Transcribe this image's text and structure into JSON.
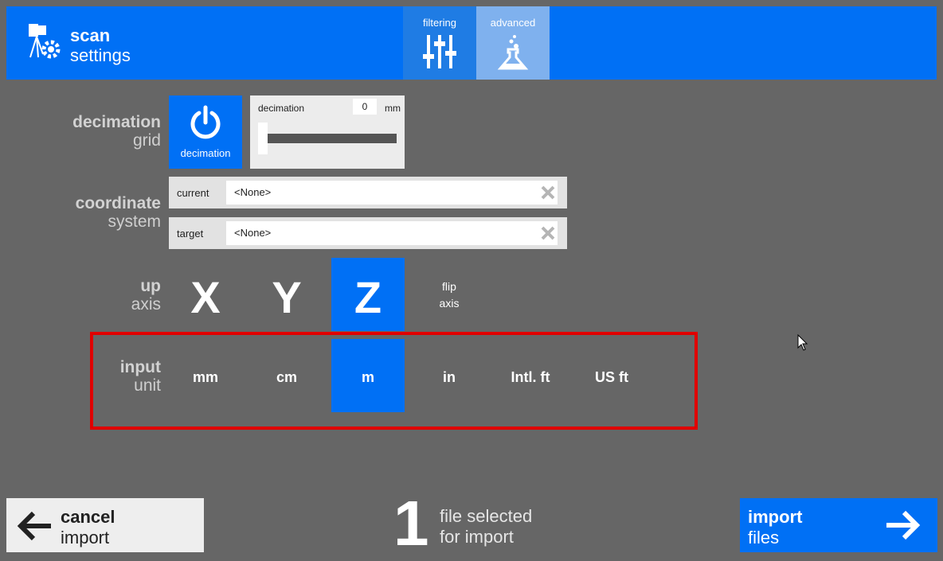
{
  "header": {
    "title_bold": "scan",
    "title_light": "settings",
    "tabs": [
      {
        "label": "filtering",
        "icon": "sliders-icon"
      },
      {
        "label": "advanced",
        "icon": "flask-icon"
      }
    ]
  },
  "decimation": {
    "row_label_bold": "decimation",
    "row_label_light": "grid",
    "toggle_label": "decimation",
    "slider_label": "decimation",
    "value": "0",
    "unit": "mm"
  },
  "coordinate": {
    "row_label_bold": "coordinate",
    "row_label_light": "system",
    "current_label": "current",
    "current_value": "<None>",
    "target_label": "target",
    "target_value": "<None>"
  },
  "up_axis": {
    "row_label_bold": "up",
    "row_label_light": "axis",
    "options": [
      "X",
      "Y",
      "Z"
    ],
    "selected": "Z",
    "flip_line1": "flip",
    "flip_line2": "axis"
  },
  "input_unit": {
    "row_label_bold": "input",
    "row_label_light": "unit",
    "options": [
      "mm",
      "cm",
      "m",
      "in",
      "Intl. ft",
      "US ft"
    ],
    "selected": "m"
  },
  "footer": {
    "cancel_bold": "cancel",
    "cancel_light": "import",
    "file_count": "1",
    "file_text_1": "file selected",
    "file_text_2": "for import",
    "import_bold": "import",
    "import_light": "files"
  },
  "colors": {
    "accent": "#0070f5",
    "background": "#666666",
    "highlight": "#e00000"
  }
}
